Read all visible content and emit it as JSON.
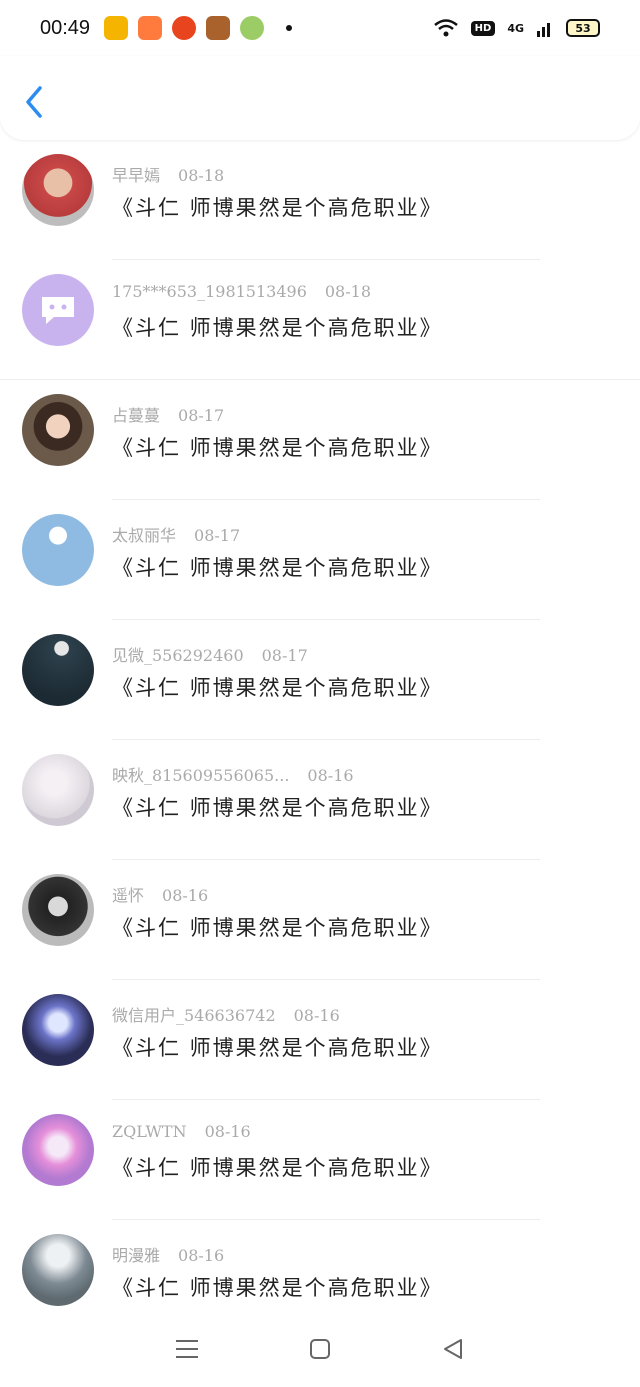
{
  "status_bar": {
    "time": "00:49",
    "hd": "HD",
    "signal": "4G",
    "battery": "53"
  },
  "header": {
    "back_icon": "chevron-left-icon"
  },
  "comments": [
    {
      "username": "早早嫣",
      "date": "08-18",
      "text": "《斗仁  师博果然是个高危职业》",
      "avatar_color": "#c84747"
    },
    {
      "username": "175***653_1981513496",
      "date": "08-18",
      "text": "《斗仁  师博果然是个高危职业》",
      "avatar_color": "#c9b3ef"
    },
    {
      "username": "占蔓蔓",
      "date": "08-17",
      "text": "《斗仁  师博果然是个高危职业》",
      "avatar_color": "#6b5a4a"
    },
    {
      "username": "太叔丽华",
      "date": "08-17",
      "text": "《斗仁  师博果然是个高危职业》",
      "avatar_color": "#8fbbe2"
    },
    {
      "username": "见微_556292460",
      "date": "08-17",
      "text": "《斗仁  师博果然是个高危职业》",
      "avatar_color": "#2c3f4a"
    },
    {
      "username": "映秋_815609556065...",
      "date": "08-16",
      "text": "《斗仁  师博果然是个高危职业》",
      "avatar_color": "#dcd8de"
    },
    {
      "username": "遥怀",
      "date": "08-16",
      "text": "《斗仁  师博果然是个高危职业》",
      "avatar_color": "#333333"
    },
    {
      "username": "微信用户_546636742",
      "date": "08-16",
      "text": "《斗仁  师博果然是个高危职业》",
      "avatar_color": "#2a2d55"
    },
    {
      "username": "ZQLWTN",
      "date": "08-16",
      "text": "《斗仁  师博果然是个高危职业》",
      "avatar_color": "#b27ad1"
    },
    {
      "username": "明漫雅",
      "date": "08-16",
      "text": "《斗仁  师博果然是个高危职业》",
      "avatar_color": "#7f8b94"
    }
  ],
  "nav": {
    "menu_icon": "menu-icon",
    "home_icon": "home-square-icon",
    "back_icon": "back-triangle-icon"
  }
}
